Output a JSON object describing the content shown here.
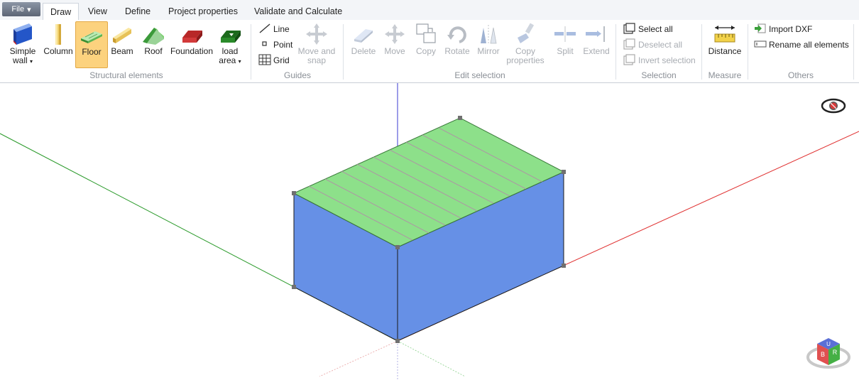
{
  "file_menu": {
    "label": "File"
  },
  "tabs": [
    {
      "label": "Draw",
      "active": true
    },
    {
      "label": "View",
      "active": false
    },
    {
      "label": "Define",
      "active": false
    },
    {
      "label": "Project properties",
      "active": false
    },
    {
      "label": "Validate and Calculate",
      "active": false
    }
  ],
  "ribbon": {
    "structural": {
      "label": "Structural elements",
      "simple_wall": {
        "label1": "Simple",
        "label2": "wall",
        "icon": "wall-icon"
      },
      "column": {
        "label": "Column",
        "icon": "column-icon"
      },
      "floor": {
        "label": "Floor",
        "icon": "floor-icon",
        "selected": true
      },
      "beam": {
        "label": "Beam",
        "icon": "beam-icon"
      },
      "roof": {
        "label": "Roof",
        "icon": "roof-icon"
      },
      "foundation": {
        "label": "Foundation",
        "icon": "foundation-icon"
      },
      "load_area": {
        "label1": "load",
        "label2": "area",
        "icon": "load-area-icon"
      }
    },
    "guides": {
      "label": "Guides",
      "line": "Line",
      "point": "Point",
      "grid": "Grid",
      "move_snap1": "Move and",
      "move_snap2": "snap"
    },
    "edit": {
      "label": "Edit selection",
      "delete": "Delete",
      "move": "Move",
      "copy": "Copy",
      "rotate": "Rotate",
      "mirror": "Mirror",
      "copy_props1": "Copy",
      "copy_props2": "properties",
      "split": "Split",
      "extend": "Extend"
    },
    "selection": {
      "label": "Selection",
      "select_all": "Select all",
      "deselect_all": "Deselect all",
      "invert": "Invert selection"
    },
    "measure": {
      "label": "Measure",
      "distance": "Distance"
    },
    "others": {
      "label": "Others",
      "import_dxf": "Import DXF",
      "rename_all": "Rename all elements"
    }
  },
  "viewport": {
    "colors": {
      "floor": "#8de08a",
      "wall": "#6690e6",
      "axis_x": "#e03030",
      "axis_y": "#2a9a2a",
      "axis_z": "#3838d0"
    },
    "nav_cube_faces": [
      "U",
      "B",
      "R"
    ],
    "visibility_icon": "eye-icon"
  }
}
